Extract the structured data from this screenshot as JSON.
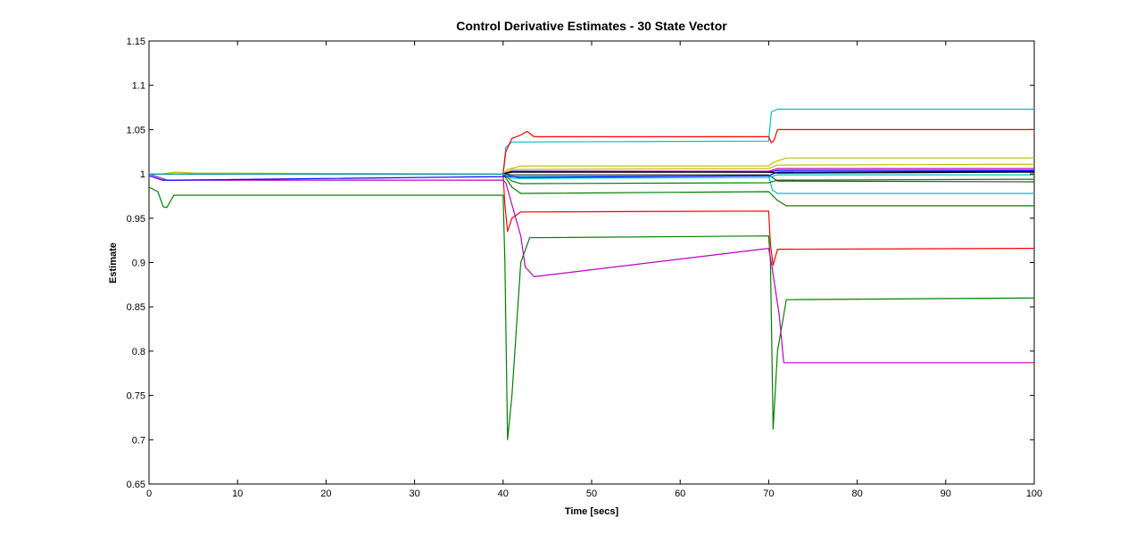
{
  "chart_data": {
    "type": "line",
    "title": "Control Derivative Estimates - 30 State Vector",
    "xlabel": "Time [secs]",
    "ylabel": "Estimate",
    "xlim": [
      0,
      100
    ],
    "ylim": [
      0.65,
      1.15
    ],
    "xticks": [
      0,
      10,
      20,
      30,
      40,
      50,
      60,
      70,
      80,
      90,
      100
    ],
    "yticks": [
      0.65,
      0.7,
      0.75,
      0.8,
      0.85,
      0.9,
      0.95,
      1,
      1.05,
      1.1,
      1.15
    ],
    "xtick_labels": [
      "0",
      "10",
      "20",
      "30",
      "40",
      "50",
      "60",
      "70",
      "80",
      "90",
      "100"
    ],
    "ytick_labels": [
      "0.65",
      "0.7",
      "0.75",
      "0.8",
      "0.85",
      "0.9",
      "0.95",
      "1",
      "1.05",
      "1.1",
      "1.15"
    ],
    "grid": false,
    "series": [
      {
        "color": "#00bfbf",
        "x": [
          0,
          40,
          40.3,
          41,
          70,
          70.3,
          71,
          100
        ],
        "y": [
          1.0,
          1.0,
          1.03,
          1.036,
          1.037,
          1.07,
          1.073,
          1.073
        ]
      },
      {
        "color": "#00bfbf",
        "x": [
          0,
          40,
          40.3,
          70,
          70.4,
          71,
          100
        ],
        "y": [
          1.0,
          1.0,
          0.997,
          0.998,
          0.982,
          0.978,
          0.978
        ]
      },
      {
        "color": "#ff0000",
        "x": [
          0,
          40,
          40.3,
          41,
          42,
          42.7,
          43.5,
          70,
          70.3,
          70.6,
          71,
          100
        ],
        "y": [
          1.0,
          1.0,
          1.025,
          1.04,
          1.044,
          1.048,
          1.042,
          1.042,
          1.035,
          1.038,
          1.05,
          1.05
        ]
      },
      {
        "color": "#ff0000",
        "x": [
          0,
          40,
          40.2,
          40.5,
          41,
          42,
          70,
          70.2,
          70.5,
          71,
          100
        ],
        "y": [
          1.0,
          1.0,
          0.965,
          0.935,
          0.95,
          0.957,
          0.958,
          0.92,
          0.897,
          0.915,
          0.916
        ]
      },
      {
        "color": "#bfbf00",
        "x": [
          0,
          1.5,
          3,
          5,
          40,
          40.5,
          42,
          70,
          70.5,
          72,
          100
        ],
        "y": [
          1.0,
          1.0,
          1.002,
          1.001,
          1.0,
          1.005,
          1.009,
          1.009,
          1.013,
          1.018,
          1.018
        ]
      },
      {
        "color": "#bfbf00",
        "x": [
          0,
          40,
          41,
          70,
          71,
          100
        ],
        "y": [
          1.0,
          1.0,
          1.005,
          1.006,
          1.01,
          1.011
        ]
      },
      {
        "color": "#008000",
        "x": [
          0,
          1,
          1.6,
          2,
          2.8,
          40,
          40.2,
          40.5,
          41,
          42,
          43,
          70,
          70.2,
          70.5,
          71,
          72,
          100
        ],
        "y": [
          0.985,
          0.98,
          0.963,
          0.962,
          0.976,
          0.976,
          0.9,
          0.7,
          0.75,
          0.9,
          0.928,
          0.93,
          0.9,
          0.712,
          0.8,
          0.858,
          0.86
        ]
      },
      {
        "color": "#008000",
        "x": [
          0,
          40,
          41,
          42,
          70,
          71,
          72,
          100
        ],
        "y": [
          1.0,
          1.0,
          0.985,
          0.978,
          0.98,
          0.97,
          0.964,
          0.964
        ]
      },
      {
        "color": "#008000",
        "x": [
          0,
          40,
          41,
          42,
          70,
          71,
          100
        ],
        "y": [
          1.0,
          1.0,
          0.992,
          0.989,
          0.99,
          0.993,
          0.994
        ]
      },
      {
        "color": "#bf00bf",
        "x": [
          0,
          2,
          40,
          40.3,
          42,
          42.5,
          43.5,
          70,
          70.3,
          71.2,
          71.7,
          100
        ],
        "y": [
          1.0,
          0.993,
          0.993,
          0.99,
          0.93,
          0.895,
          0.884,
          0.916,
          0.9,
          0.84,
          0.787,
          0.787
        ]
      },
      {
        "color": "#bf00bf",
        "x": [
          0,
          40,
          41,
          70,
          71,
          100
        ],
        "y": [
          1.0,
          1.0,
          1.003,
          1.003,
          1.006,
          1.006
        ]
      },
      {
        "color": "#0000ff",
        "x": [
          0,
          1.5,
          3,
          40,
          40.5,
          42,
          70,
          71,
          100
        ],
        "y": [
          0.998,
          0.993,
          0.993,
          0.997,
          0.998,
          0.996,
          0.998,
          1.002,
          1.003
        ]
      },
      {
        "color": "#0000ff",
        "x": [
          0,
          40,
          41,
          70,
          71,
          100
        ],
        "y": [
          1.0,
          1.0,
          1.003,
          1.002,
          1.004,
          1.004
        ]
      },
      {
        "color": "#000000",
        "x": [
          0,
          40,
          41,
          70,
          71,
          100
        ],
        "y": [
          1.0,
          1.0,
          1.002,
          1.002,
          1.001,
          1.002
        ]
      },
      {
        "color": "#404040",
        "x": [
          0,
          40,
          41,
          70,
          71,
          100
        ],
        "y": [
          1.0,
          1.0,
          0.999,
          0.999,
          0.992,
          0.991
        ]
      },
      {
        "color": "#00bfbf",
        "x": [
          0,
          40,
          41,
          70,
          71,
          100
        ],
        "y": [
          1.0,
          1.0,
          0.995,
          0.996,
          0.999,
          0.999
        ]
      }
    ]
  }
}
